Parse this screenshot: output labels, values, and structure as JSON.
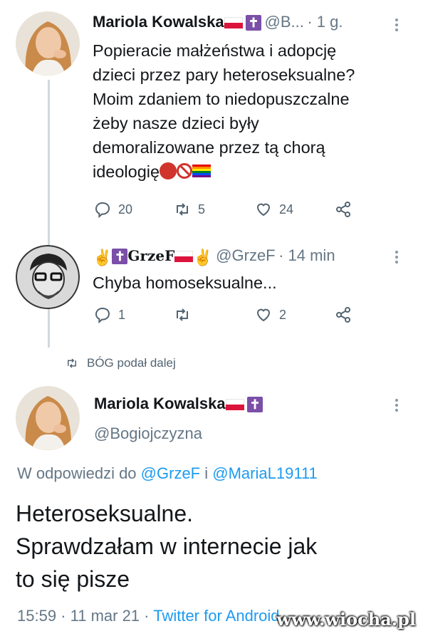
{
  "tweet1": {
    "name": "Mariola Kowalska",
    "handle": "@B...",
    "time": "· 1 g.",
    "text_lines": [
      "Popieracie małżeństwa i adopcję",
      "dzieci przez pary heteroseksualne?",
      "Moim zdaniem to niedopuszczalne",
      "żeby nasze dzieci były",
      "demoralizowane przez tą chorą",
      "ideologię"
    ],
    "replies": "20",
    "retweets": "5",
    "likes": "24"
  },
  "tweet2": {
    "name": "GrzeF",
    "handle": "@GrzeF",
    "time": "· 14 min",
    "text": "Chyba homoseksualne...",
    "replies": "1",
    "retweets": "",
    "likes": "2"
  },
  "retweet_note": "BÓG podał dalej",
  "tweet3": {
    "name": "Mariola Kowalska",
    "handle": "@Bogiojczyzna",
    "reply_prefix": "W odpowiedzi do",
    "reply_user1": "@GrzeF",
    "reply_and": "i",
    "reply_user2": "@MariaL19111",
    "text_lines": [
      "Heteroseksualne.",
      "Sprawdzałam w internecie jak",
      "to się pisze"
    ],
    "time": "15:59",
    "date": "· 11 mar 21 ·",
    "client": "Twitter for Android"
  },
  "watermark": "www.wiocha.pl",
  "colors": {
    "link": "#1d9bf0",
    "muted": "#657786",
    "thread_line": "#cfd9de",
    "cross": "#7b4fa8",
    "flag_red": "#dc143c"
  },
  "icons": [
    "reply-icon",
    "retweet-icon",
    "like-icon",
    "share-icon",
    "more-icon",
    "cross-icon",
    "poland-flag-icon",
    "victory-hand-icon"
  ]
}
